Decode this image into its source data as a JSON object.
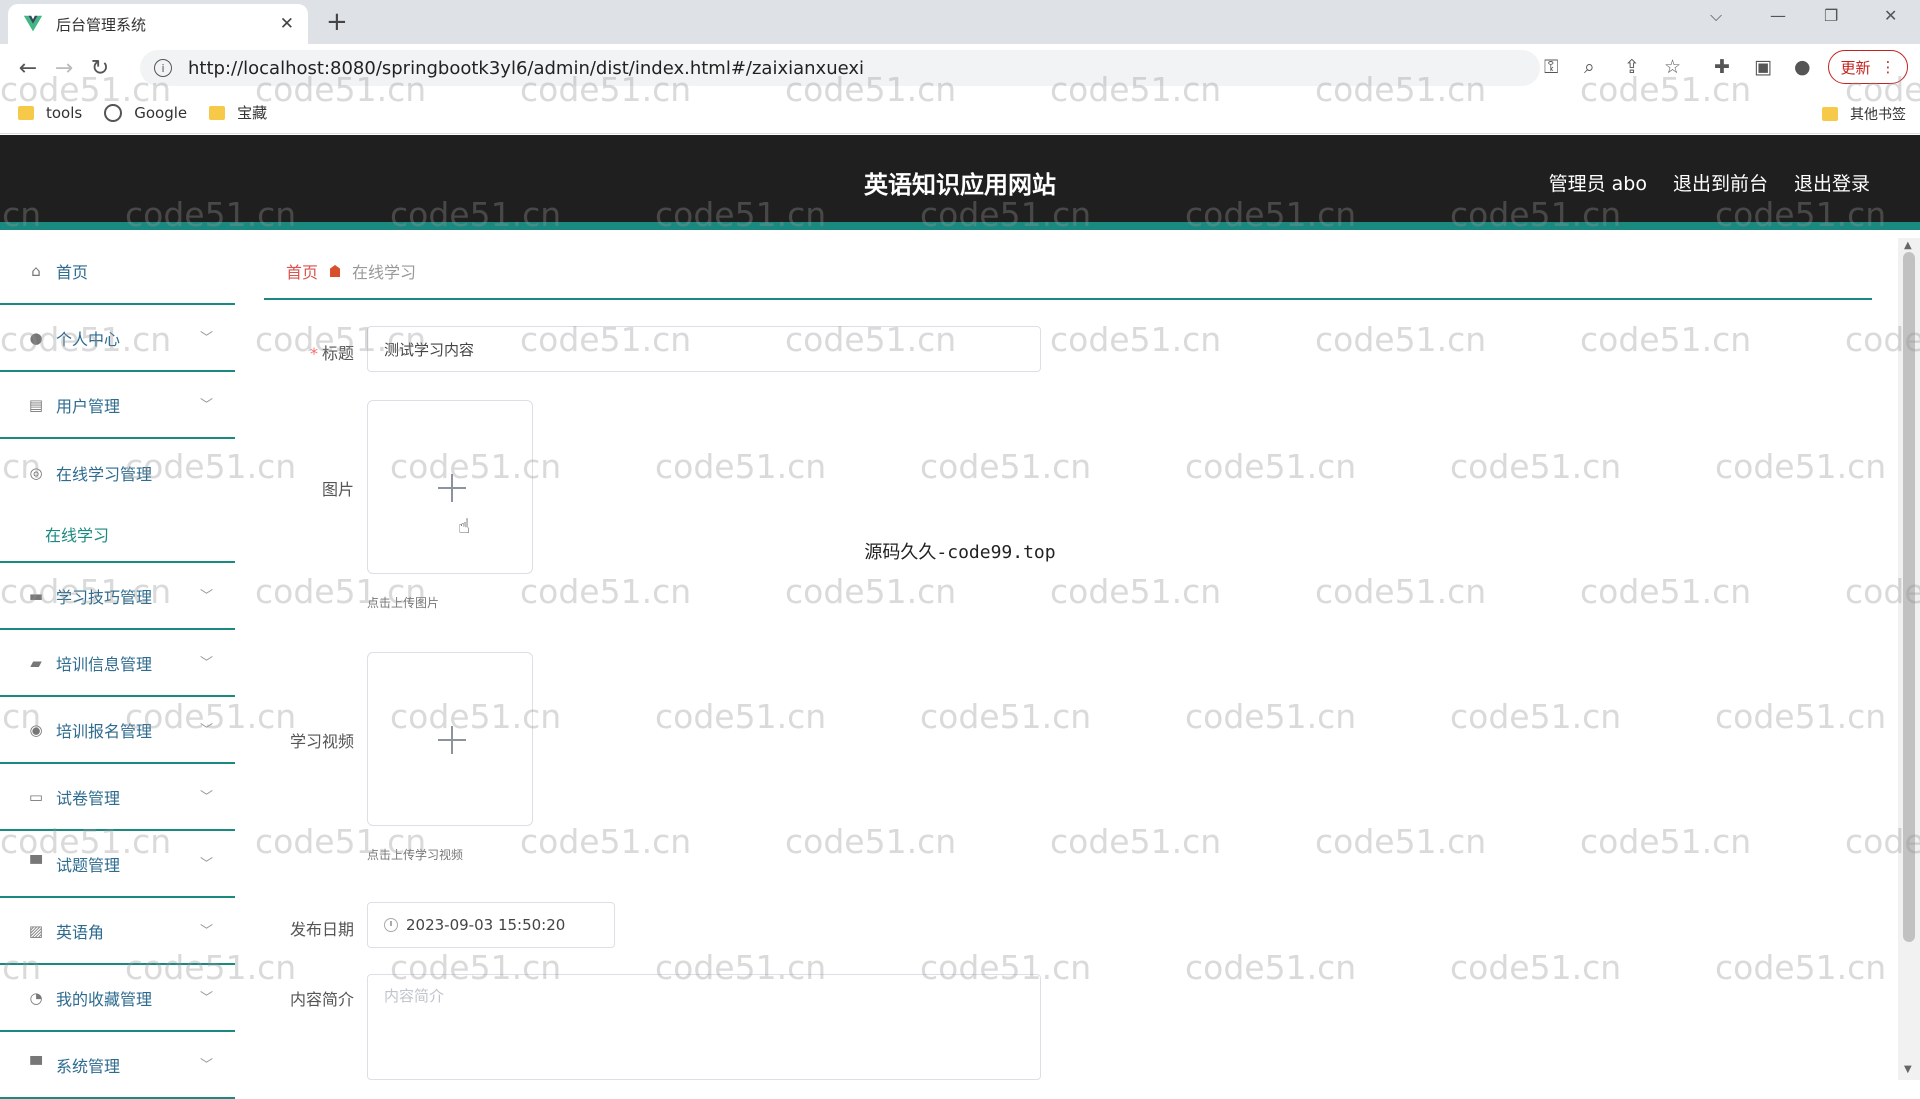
{
  "browser": {
    "tab_title": "后台管理系统",
    "url": "http://localhost:8080/springbootk3yl6/admin/dist/index.html#/zaixianxuexi",
    "update_label": "更新",
    "bookmarks": [
      "tools",
      "Google",
      "宝藏"
    ],
    "other_bookmarks": "其他书签"
  },
  "header": {
    "title": "英语知识应用网站",
    "admin": "管理员 abo",
    "to_front": "退出到前台",
    "logout": "退出登录"
  },
  "sidebar": {
    "items": [
      {
        "label": "首页",
        "icon": "home-icon"
      },
      {
        "label": "个人中心",
        "icon": "user-icon"
      },
      {
        "label": "用户管理",
        "icon": "clipboard-icon"
      },
      {
        "label": "在线学习管理",
        "icon": "help-circle-icon"
      },
      {
        "label": "在线学习",
        "icon": ""
      },
      {
        "label": "学习技巧管理",
        "icon": "chat-icon"
      },
      {
        "label": "培训信息管理",
        "icon": "briefcase-icon"
      },
      {
        "label": "培训报名管理",
        "icon": "pin-icon"
      },
      {
        "label": "试卷管理",
        "icon": "message-icon"
      },
      {
        "label": "试题管理",
        "icon": "monitor-icon"
      },
      {
        "label": "英语角",
        "icon": "chart-icon"
      },
      {
        "label": "我的收藏管理",
        "icon": "star-circle-icon"
      },
      {
        "label": "系统管理",
        "icon": "monitor-icon"
      }
    ]
  },
  "breadcrumb": {
    "home": "首页",
    "current": "在线学习"
  },
  "form": {
    "title_label": "标题",
    "title_value": "测试学习内容",
    "image_label": "图片",
    "image_hint": "点击上传图片",
    "video_label": "学习视频",
    "video_hint": "点击上传学习视频",
    "date_label": "发布日期",
    "date_value": "2023-09-03 15:50:20",
    "intro_label": "内容简介",
    "intro_placeholder": "内容简介"
  },
  "overlay_text": "源码久久-code99.top",
  "watermark": "code51.cn",
  "colors": {
    "accent": "#1a8a80",
    "header_bg": "#1f1f1f",
    "breadcrumb_home": "#d9534f"
  }
}
